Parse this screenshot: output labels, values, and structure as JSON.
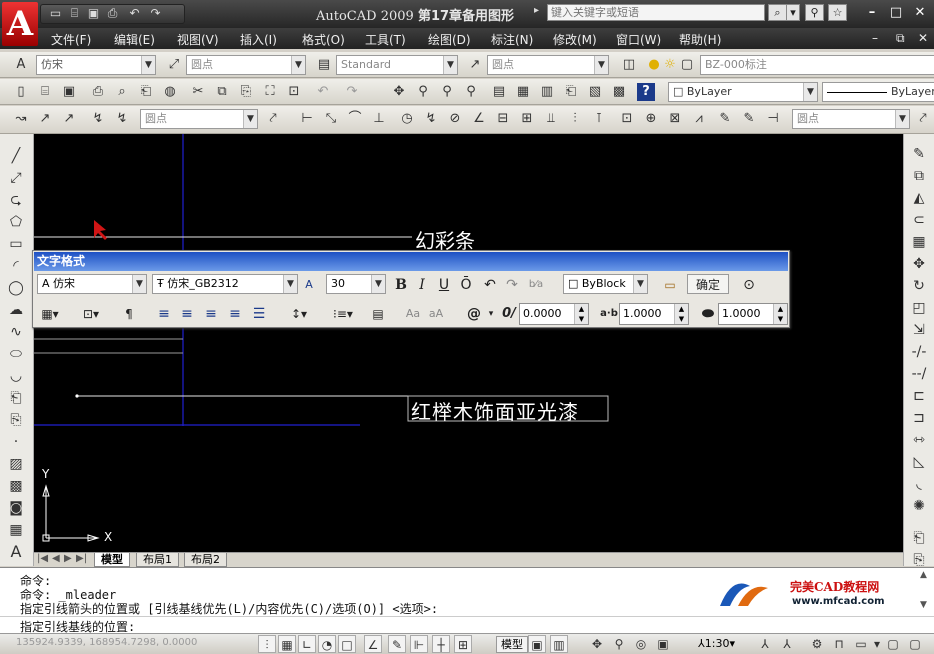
{
  "window": {
    "app": "AutoCAD 2009",
    "doc": "第17章备用图形",
    "search_placeholder": "键入关键字或短语"
  },
  "menu": [
    "文件(F)",
    "编辑(E)",
    "视图(V)",
    "插入(I)",
    "格式(O)",
    "工具(T)",
    "绘图(D)",
    "标注(N)",
    "修改(M)",
    "窗口(W)",
    "帮助(H)"
  ],
  "toolbar1": {
    "text_style": "仿宋",
    "dim_layer": "圆点",
    "table_style": "Standard",
    "ml_style": "圆点",
    "layer": "BZ-000标注"
  },
  "toolbar2": {
    "color": "ByLayer",
    "linetype": "ByLayer"
  },
  "toolbar3": {
    "dim_style": "圆点",
    "dim_style2": "圆点"
  },
  "drawing": {
    "label1": "幻彩条",
    "label2": "红榉木饰面亚光漆",
    "axis_x": "X",
    "axis_y": "Y"
  },
  "text_format": {
    "title": "文字格式",
    "style": "仿宋",
    "font": "仿宋_GB2312",
    "height": "30",
    "bold": "B",
    "italic": "I",
    "underline": "U",
    "overline": "Ō",
    "color": "ByBlock",
    "ok": "确定",
    "oblique": "0.0000",
    "tracking": "1.0000",
    "width_factor": "1.0000",
    "case_upper": "Aa",
    "case_lower": "aA",
    "symbol": "@"
  },
  "tabs": [
    "模型",
    "布局1",
    "布局2"
  ],
  "command": {
    "line1": "命令:",
    "line2": "命令:  _mleader",
    "line3": "指定引线箭头的位置或 [引线基线优先(L)/内容优先(C)/选项(O)] <选项>:",
    "line4": "指定引线基线的位置:"
  },
  "status": {
    "coords": "135924.9339, 168954.7298, 0.0000",
    "model": "模型",
    "scale": "1:30"
  },
  "watermark": {
    "name": "完美CAD教程网",
    "url": "www.mfcad.com"
  },
  "colors": {
    "accent": "#1e50c4",
    "canvas": "#000000",
    "drawline_blue": "#2020d0",
    "cursor": "#d01515"
  }
}
